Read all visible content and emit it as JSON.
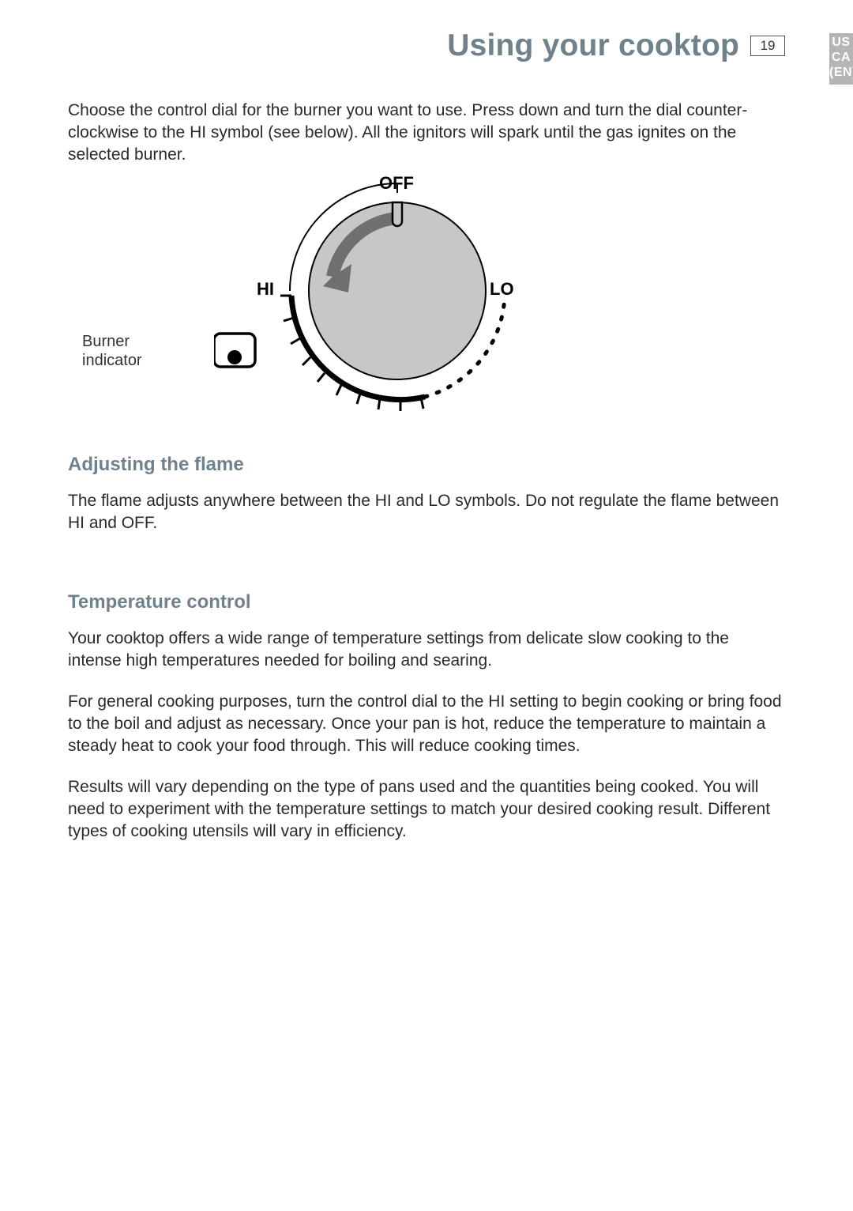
{
  "header": {
    "title": "Using your cooktop",
    "page_number": "19"
  },
  "lang_tab": {
    "line1": "US",
    "line2": "CA",
    "line3": "(EN)"
  },
  "intro": "Choose the control dial for the burner you want to use.  Press down and turn the dial counter-clockwise to the HI symbol (see below).   All the ignitors will spark until the gas ignites on the selected burner.",
  "dial": {
    "off": "OFF",
    "hi": "HI",
    "lo": "LO"
  },
  "callout": {
    "line1": "Burner",
    "line2": "indicator"
  },
  "section1": {
    "heading": "Adjusting the flame",
    "para": "The flame adjusts anywhere between the HI and LO symbols. Do not regulate the flame between HI and OFF."
  },
  "section2": {
    "heading": "Temperature control",
    "para1": "Your cooktop offers a wide range of temperature settings from delicate slow cooking to the intense high temperatures needed for boiling and searing.",
    "para2": "For general cooking purposes, turn the control dial to the HI setting to begin cooking or bring food to the boil and adjust as necessary.  Once your pan is hot, reduce the temperature to maintain a steady heat to cook your food through.  This will reduce cooking times.",
    "para3": "Results will vary depending on the type of pans used and the quantities being cooked.  You will need to experiment with the temperature settings to match your desired cooking result.  Different types of cooking utensils will vary in efficiency."
  }
}
